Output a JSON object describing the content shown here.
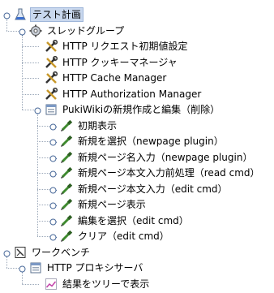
{
  "tree": {
    "nodes": [
      {
        "label": "テスト計画",
        "icon": "test-plan-flask-icon",
        "depth": 0,
        "expanded": true,
        "selected": true
      },
      {
        "label": "スレッドグループ",
        "icon": "thread-group-gear-icon",
        "depth": 1,
        "expanded": true
      },
      {
        "label": "HTTP リクエスト初期値設定",
        "icon": "config-tools-icon",
        "depth": 2
      },
      {
        "label": "HTTP クッキーマネージャ",
        "icon": "config-tools-icon",
        "depth": 2
      },
      {
        "label": "HTTP Cache Manager",
        "icon": "config-tools-icon",
        "depth": 2
      },
      {
        "label": "HTTP Authorization Manager",
        "icon": "config-tools-icon",
        "depth": 2
      },
      {
        "label": "PukiWikiの新規作成と編集（削除）",
        "icon": "controller-window-icon",
        "depth": 2,
        "expanded": true
      },
      {
        "label": "初期表示",
        "icon": "sampler-pipette-icon",
        "depth": 3,
        "collapsed": true
      },
      {
        "label": "新規を選択（newpage plugin）",
        "icon": "sampler-pipette-icon",
        "depth": 3,
        "collapsed": true
      },
      {
        "label": "新規ページ名入力（newpage plugin）",
        "icon": "sampler-pipette-icon",
        "depth": 3,
        "collapsed": true
      },
      {
        "label": "新規ページ本文入力前処理（read cmd）",
        "icon": "sampler-pipette-icon",
        "depth": 3,
        "collapsed": true
      },
      {
        "label": "新規ページ本文入力（edit cmd）",
        "icon": "sampler-pipette-icon",
        "depth": 3,
        "collapsed": true
      },
      {
        "label": "新規ページ表示",
        "icon": "sampler-pipette-icon",
        "depth": 3,
        "collapsed": true
      },
      {
        "label": "編集を選択（edit cmd）",
        "icon": "sampler-pipette-icon",
        "depth": 3,
        "collapsed": true
      },
      {
        "label": "クリア（edit cmd）",
        "icon": "sampler-pipette-icon",
        "depth": 3,
        "collapsed": true
      },
      {
        "label": "ワークベンチ",
        "icon": "workbench-notepad-icon",
        "depth": 0,
        "expanded": true
      },
      {
        "label": "HTTP プロキシサーバ",
        "icon": "controller-window-icon",
        "depth": 1,
        "expanded": true
      },
      {
        "label": "結果をツリーで表示",
        "icon": "listener-graph-icon",
        "depth": 2
      }
    ]
  },
  "colors": {
    "selection_bg": "#c9d8ee",
    "guide_line": "#9aa7b8",
    "handle": "#4a6a9a"
  }
}
